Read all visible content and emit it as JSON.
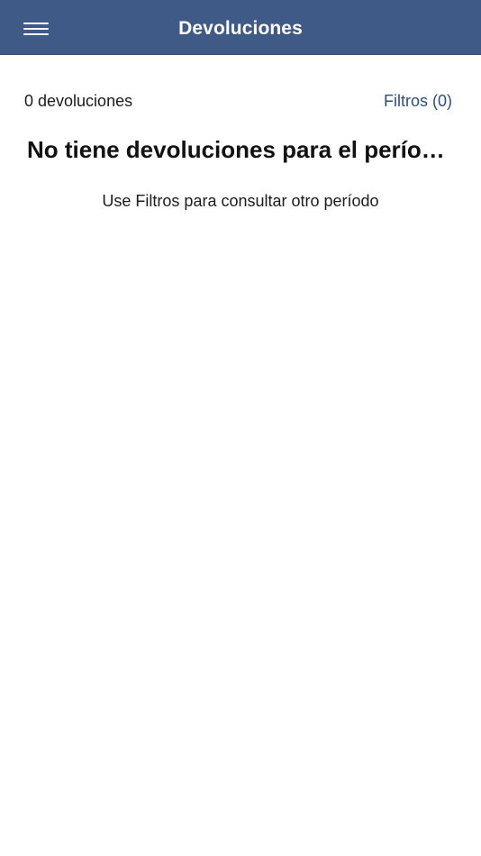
{
  "header": {
    "title": "Devoluciones",
    "menu_icon": "hamburger-menu-icon"
  },
  "summary": {
    "count_label": "0 devoluciones",
    "filters_label": "Filtros (0)"
  },
  "empty_state": {
    "title": "No tiene devoluciones para el período seleccionado",
    "hint": "Use Filtros para consultar otro período"
  },
  "colors": {
    "navbar": "#3f5a87",
    "link": "#2f4f7f"
  }
}
